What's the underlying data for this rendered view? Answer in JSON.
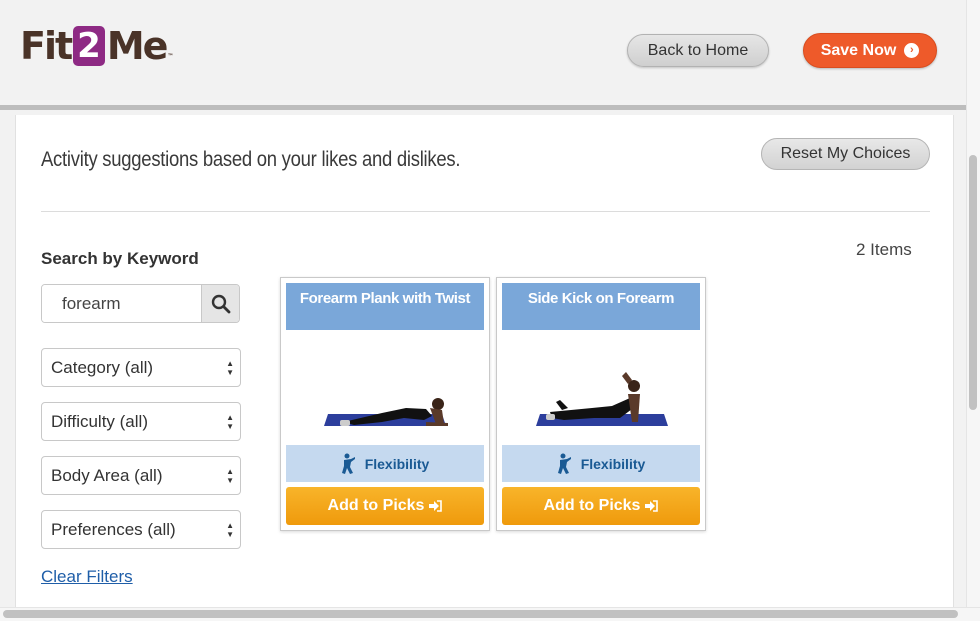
{
  "header": {
    "logo_text_1": "Fit",
    "logo_text_2": "2",
    "logo_text_3": "Me",
    "logo_tm": "TM",
    "back_home_label": "Back to Home",
    "save_now_label": "Save Now"
  },
  "main": {
    "headline": "Activity suggestions based on your likes and dislikes.",
    "reset_label": "Reset My Choices",
    "item_count": "2 Items"
  },
  "filters": {
    "search_label": "Search by Keyword",
    "search_value": "forearm",
    "selects": [
      {
        "label": "Category (all)"
      },
      {
        "label": "Difficulty (all)"
      },
      {
        "label": "Body Area (all)"
      },
      {
        "label": "Preferences (all)"
      }
    ],
    "clear_label": "Clear Filters"
  },
  "cards": [
    {
      "title": "Forearm Plank with Twist",
      "category": "Flexibility",
      "add_label": "Add to Picks"
    },
    {
      "title": "Side Kick on Forearm",
      "category": "Flexibility",
      "add_label": "Add to Picks"
    }
  ],
  "colors": {
    "brand": "#4a3328",
    "brand_accent": "#8e2a84",
    "save_button": "#ee5a2a",
    "card_title_bg": "#7aa7d9",
    "card_category_bg": "#c5d9ef",
    "add_button": "#f5a623",
    "link": "#1f5ea8"
  },
  "icons": {
    "search": "magnifier-icon",
    "save": "chevron-circle-right-icon",
    "category": "flexibility-figure-icon",
    "add": "sign-in-arrow-icon"
  }
}
